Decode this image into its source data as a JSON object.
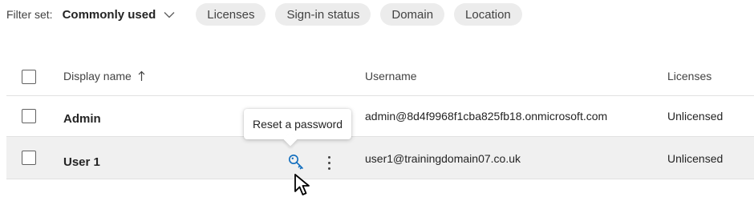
{
  "filter": {
    "label": "Filter set:",
    "selected": "Commonly used",
    "pills": [
      "Licenses",
      "Sign-in status",
      "Domain",
      "Location"
    ]
  },
  "table": {
    "columns": {
      "display_name": "Display name",
      "username": "Username",
      "licenses": "Licenses"
    },
    "sort": "ascending",
    "rows": [
      {
        "display_name": "Admin",
        "username": "admin@8d4f9968f1cba825fb18.onmicrosoft.com",
        "licenses": "Unlicensed"
      },
      {
        "display_name": "User 1",
        "username": "user1@trainingdomain07.co.uk",
        "licenses": "Unlicensed"
      }
    ]
  },
  "tooltip": {
    "text": "Reset a password"
  },
  "icons": {
    "chevron": "chevron-down-icon",
    "sort": "arrow-up-icon",
    "reset": "key-icon",
    "more": "more-vertical-icon",
    "cursor": "mouse-pointer-icon"
  },
  "colors": {
    "accent": "#0f6cbd",
    "row_selected": "#f0f0f0",
    "pill_bg": "#ececec"
  }
}
